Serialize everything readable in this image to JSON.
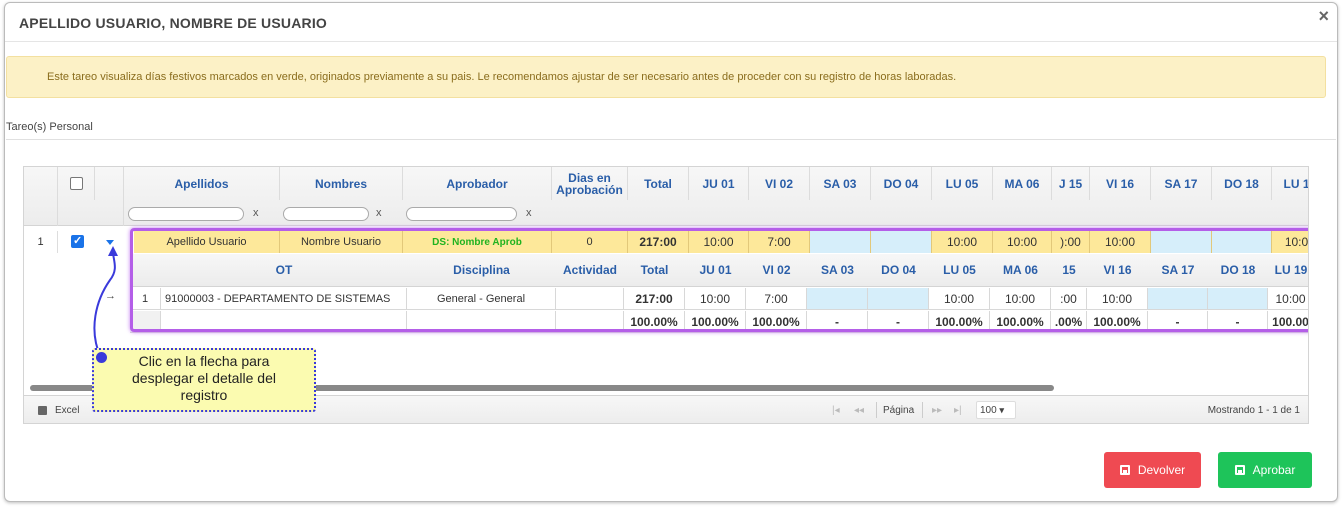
{
  "modal": {
    "title": "APELLIDO USUARIO, NOMBRE DE USUARIO",
    "close": "×"
  },
  "alert": {
    "text": "Este tareo visualiza días festivos marcados en verde, originados previamente a su pais. Le recomendamos ajustar de ser necesario antes de proceder con su registro de horas laboradas."
  },
  "section": {
    "label": "Tareo(s) Personal"
  },
  "grid": {
    "headers": {
      "apellidos": "Apellidos",
      "nombres": "Nombres",
      "aprobador": "Aprobador",
      "dias1": "Dias en",
      "dias2": "Aprobación",
      "total": "Total",
      "days": [
        "JU 01",
        "VI 02",
        "SA 03",
        "DO 04",
        "LU 05",
        "MA 06",
        "J 15",
        "VI 16",
        "SA 17",
        "DO 18",
        "LU 1"
      ]
    },
    "filter_clear": "x",
    "row": {
      "index": "1",
      "apellidos": "Apellido Usuario",
      "nombres": "Nombre Usuario",
      "aprobador": "DS: Nombre Aprob",
      "dias": "0",
      "total": "217:00",
      "days": [
        "10:00",
        "7:00",
        "",
        "",
        "10:00",
        "10:00",
        "):00",
        "10:00",
        "",
        "",
        "10:0"
      ]
    },
    "detail": {
      "headers": {
        "ot": "OT",
        "disciplina": "Disciplina",
        "actividad": "Actividad",
        "total": "Total",
        "days": [
          "JU 01",
          "VI 02",
          "SA 03",
          "DO 04",
          "LU 05",
          "MA 06",
          "15",
          "VI 16",
          "SA 17",
          "DO 18",
          "LU 19"
        ]
      },
      "row": {
        "index": "1",
        "ot": "91000003 - DEPARTAMENTO DE SISTEMAS",
        "disciplina": "General - General",
        "actividad": "",
        "total": "217:00",
        "days": [
          "10:00",
          "7:00",
          "",
          "",
          "10:00",
          "10:00",
          ":00",
          "10:00",
          "",
          "",
          "10:00"
        ]
      },
      "footer": {
        "total": "100.00%",
        "days": [
          "100.00%",
          "100.00%",
          "-",
          "-",
          "100.00%",
          "100.00%",
          ".00%",
          "100.00%",
          "-",
          "-",
          "100.00"
        ]
      }
    },
    "pager": {
      "excel": "Excel",
      "pagina": "Página",
      "page_size": "100",
      "showing": "Mostrando 1 - 1 de 1"
    }
  },
  "callout": {
    "line1": "Clic en la flecha para",
    "line2": "desplegar el detalle del",
    "line3": "registro"
  },
  "buttons": {
    "devolver": "Devolver",
    "aprobar": "Aprobar"
  },
  "colors": {
    "row_yellow": "#fde89a",
    "holiday_blue": "#d6eefa",
    "approver_green": "#1fb31f",
    "header_blue": "#2a5ea8",
    "highlight_purple": "#b45ee8",
    "button_red": "#ef4a52",
    "button_green": "#1ec45a"
  }
}
